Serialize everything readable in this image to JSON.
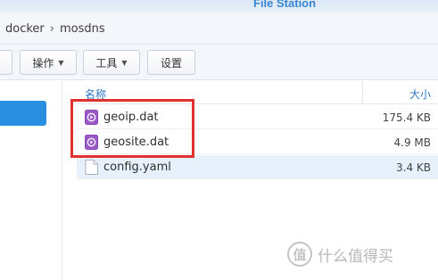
{
  "window": {
    "title": "File Station"
  },
  "breadcrumb": {
    "items": [
      "docker",
      "mosdns"
    ],
    "separator": "›"
  },
  "toolbar": {
    "action_label": "操作",
    "tools_label": "工具",
    "settings_label": "设置"
  },
  "file_list": {
    "columns": {
      "name": "名称",
      "size": "大小"
    },
    "rows": [
      {
        "name": "geoip.dat",
        "size": "175.4 KB",
        "icon": "dat-file-icon"
      },
      {
        "name": "geosite.dat",
        "size": "4.9 MB",
        "icon": "dat-file-icon"
      },
      {
        "name": "config.yaml",
        "size": "3.4 KB",
        "icon": "text-file-icon",
        "selected": true
      }
    ]
  },
  "watermark": {
    "text": "什么值得买"
  },
  "colors": {
    "accent": "#2a8fe0",
    "title": "#3a86d6",
    "highlight": "#e03131",
    "dat_icon": "#9b59c6"
  }
}
